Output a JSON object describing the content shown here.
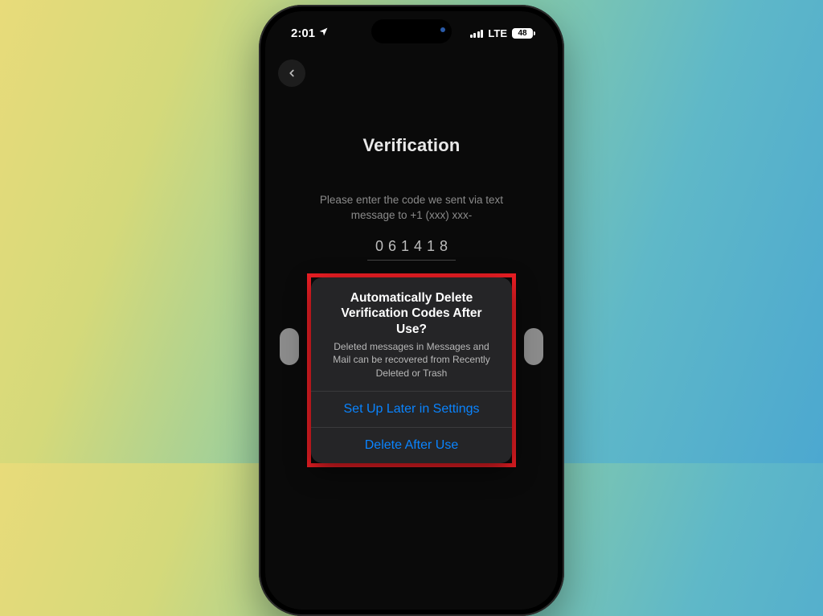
{
  "status": {
    "time": "2:01",
    "network": "LTE",
    "battery": "48"
  },
  "page": {
    "title": "Verification",
    "prompt_line1": "Please enter the code we sent via text",
    "prompt_line2": "message to +1 (xxx) xxx-",
    "code": "061418"
  },
  "alert": {
    "title_line1": "Automatically Delete",
    "title_line2": "Verification Codes After Use?",
    "body": "Deleted messages in Messages and Mail can be recovered from Recently Deleted or Trash",
    "button_later": "Set Up Later in Settings",
    "button_delete": "Delete After Use"
  }
}
